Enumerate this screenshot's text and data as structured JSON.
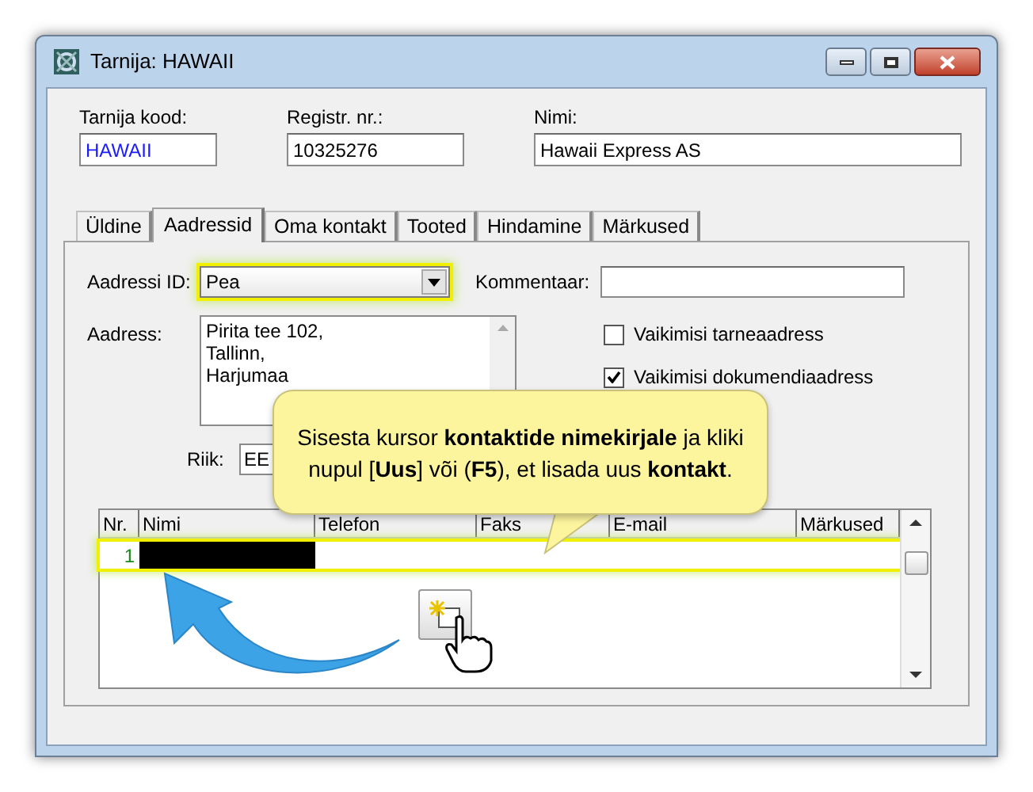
{
  "window": {
    "title": "Tarnija: HAWAII"
  },
  "header_fields": [
    {
      "label": "Tarnija kood:",
      "value": "HAWAII",
      "kind": "code"
    },
    {
      "label": "Registr. nr.:",
      "value": "10325276",
      "kind": "plain"
    },
    {
      "label": "Nimi:",
      "value": "Hawaii Express AS",
      "kind": "plain"
    }
  ],
  "tabs": [
    {
      "label": "Üldine",
      "selected": false
    },
    {
      "label": "Aadressid",
      "selected": true
    },
    {
      "label": "Oma kontakt",
      "selected": false
    },
    {
      "label": "Tooted",
      "selected": false
    },
    {
      "label": "Hindamine",
      "selected": false
    },
    {
      "label": "Märkused",
      "selected": false
    }
  ],
  "address_id": {
    "label": "Aadressi ID:",
    "value": "Pea",
    "highlighted": true
  },
  "comment": {
    "label": "Kommentaar:"
  },
  "address": {
    "label": "Aadress:",
    "lines": [
      "Pirita tee 102,",
      "Tallinn,",
      "Harjumaa"
    ]
  },
  "checkboxes": [
    {
      "label": "Vaikimisi tarneaadress",
      "checked": false
    },
    {
      "label": "Vaikimisi dokumendiaadress",
      "checked": true
    }
  ],
  "country": {
    "label": "Riik:",
    "value": "EE"
  },
  "contacts": {
    "columns": [
      "Nr.",
      "Nimi",
      "Telefon",
      "Faks",
      "E-mail",
      "Märkused"
    ],
    "rows": [
      {
        "nr": "1",
        "selected": true,
        "name_redacted": true
      }
    ]
  },
  "callout": {
    "text": "Sisesta kursor **kontaktide nimekirjale** ja kliki nupul [**Uus**] või (**F5**), et lisada uus **kontakt**."
  }
}
